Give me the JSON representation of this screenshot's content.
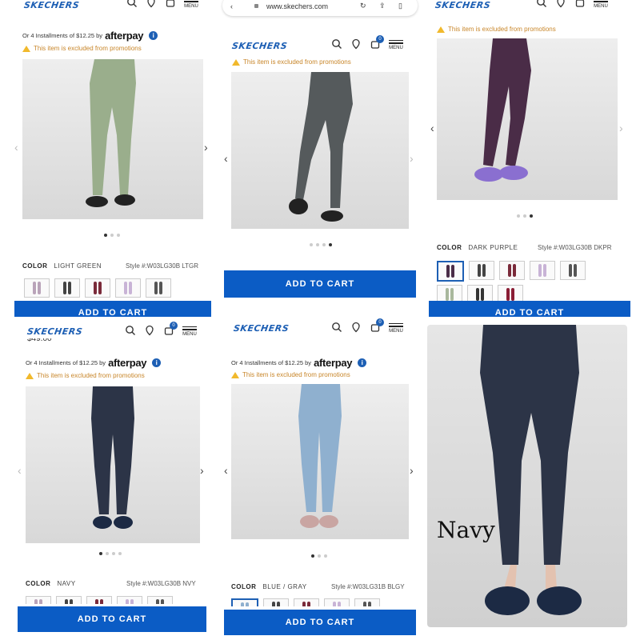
{
  "brand": "SKECHERS",
  "menu_label": "MENU",
  "cart_count": "0",
  "installments_text": "Or 4 Installments of $12.25 by",
  "afterpay_label": "afterpay",
  "promo_text": "This item is excluded from promotions",
  "color_label": "COLOR",
  "add_to_cart": "ADD TO CART",
  "browser_url": "www.skechers.com",
  "price_partial": "$49.00",
  "panels": [
    {
      "id": "light-green",
      "color_name": "LIGHT GREEN",
      "style": "Style #:W03LG30B LTGR",
      "legging_color": "#9aae8c",
      "active_dot": 0,
      "dot_count": 3
    },
    {
      "id": "charcoal",
      "color_name": "",
      "style": "",
      "legging_color": "#555a5c",
      "active_dot": 3,
      "dot_count": 4
    },
    {
      "id": "dark-purple",
      "color_name": "DARK PURPLE",
      "style": "Style #:W03LG30B DKPR",
      "legging_color": "#4a2c47",
      "active_dot": 2,
      "dot_count": 3
    },
    {
      "id": "navy",
      "color_name": "NAVY",
      "style": "Style #:W03LG30B NVY",
      "legging_color": "#2c3447",
      "active_dot": 0,
      "dot_count": 4
    },
    {
      "id": "blue-gray",
      "color_name": "BLUE / GRAY",
      "style": "Style #:W03LG31B BLGY",
      "legging_color": "#8fb0cf",
      "active_dot": 0,
      "dot_count": 3
    }
  ],
  "caption": "Navy",
  "colors": {
    "accent": "#0b5cc5",
    "brand": "#1d5fb4",
    "promo": "#c8862a"
  }
}
